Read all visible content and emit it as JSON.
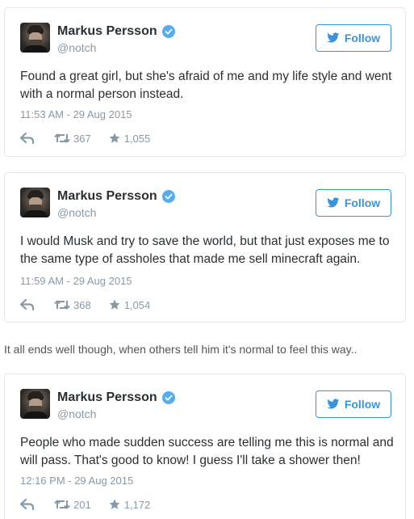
{
  "tweets": [
    {
      "name": "Markus Persson",
      "handle": "@notch",
      "follow_label": "Follow",
      "text": "Found a great girl, but she's afraid of me and my life style and went with a normal person instead.",
      "timestamp": "11:53 AM - 29 Aug 2015",
      "retweets": "367",
      "likes": "1,055"
    },
    {
      "name": "Markus Persson",
      "handle": "@notch",
      "follow_label": "Follow",
      "text": "I would Musk and try to save the world, but that just exposes me to the same type of assholes that made me sell minecraft again.",
      "timestamp": "11:59 AM - 29 Aug 2015",
      "retweets": "368",
      "likes": "1,054"
    },
    {
      "name": "Markus Persson",
      "handle": "@notch",
      "follow_label": "Follow",
      "text": "People who made sudden success are telling me this is normal and will pass. That's good to know! I guess I'll take a shower then!",
      "timestamp": "12:16 PM - 29 Aug 2015",
      "retweets": "201",
      "likes": "1,172"
    }
  ],
  "caption": "It all ends well though, when others tell him it's normal to feel this way..",
  "colors": {
    "twitter_blue": "#3b94d9",
    "verified_blue": "#55acee",
    "muted_gray": "#8899a6",
    "text": "#292f33",
    "border": "#e1e8ed"
  },
  "icons": {
    "verified": "verified-badge-icon",
    "follow": "twitter-bird-icon",
    "reply": "reply-arrow-icon",
    "retweet": "retweet-icon",
    "like": "star-icon"
  }
}
